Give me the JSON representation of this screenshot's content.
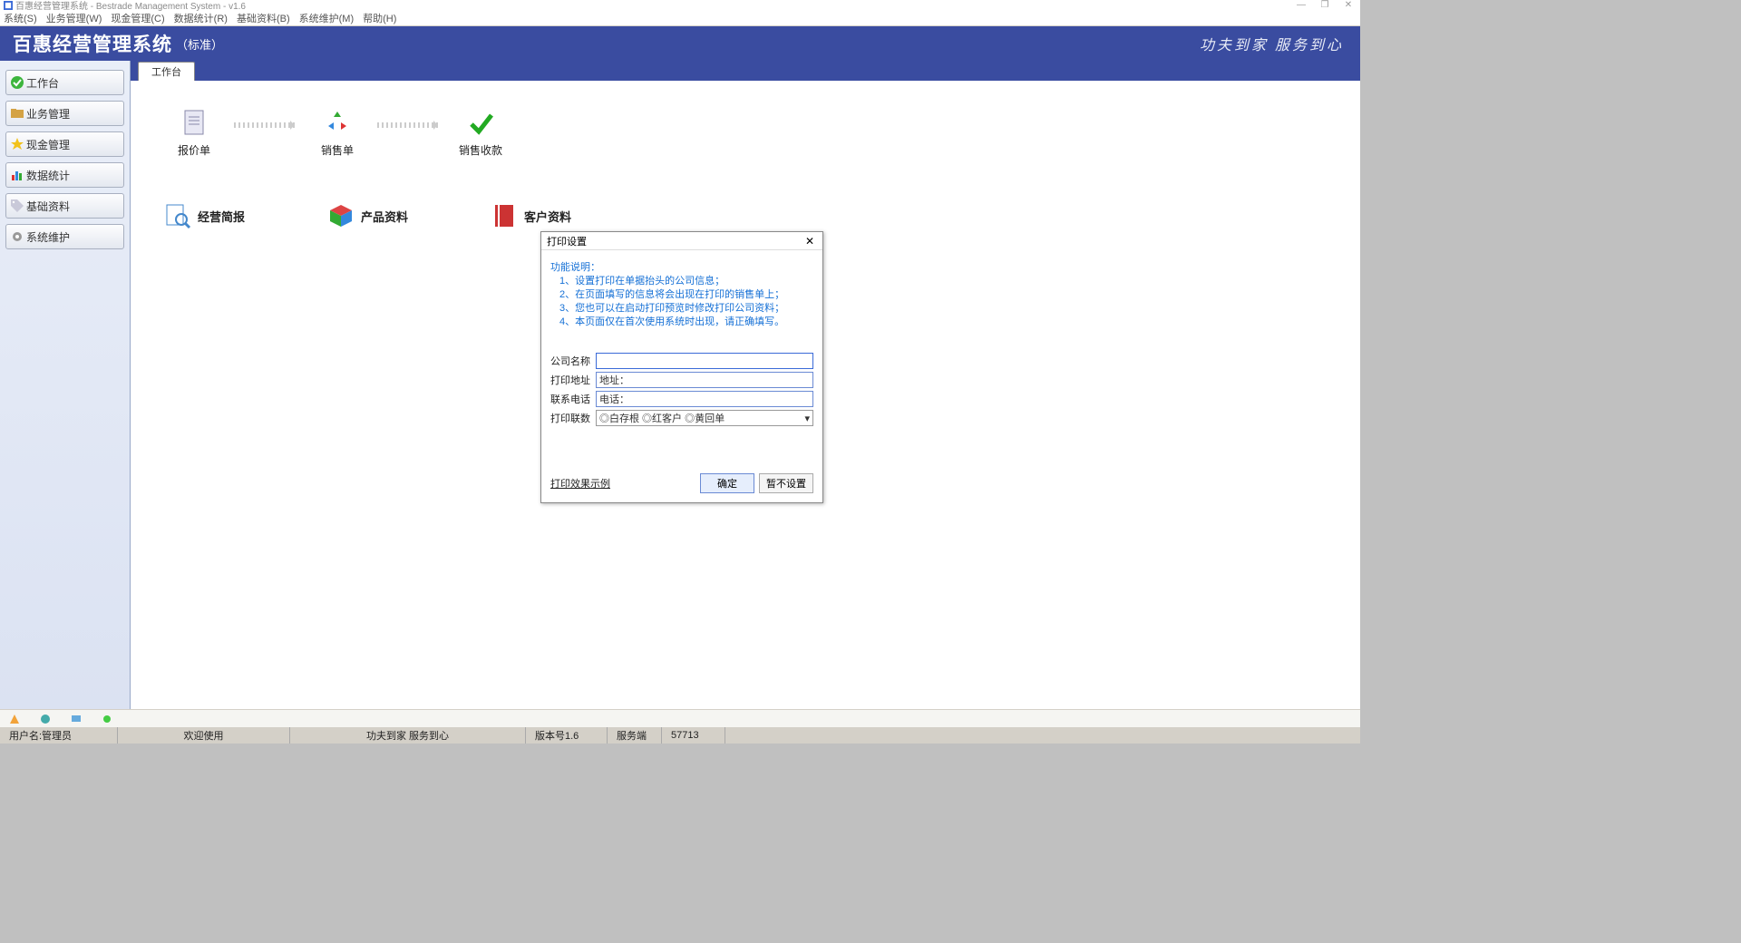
{
  "window": {
    "title": "百惠经营管理系统 - Bestrade Management System - v1.6",
    "minimize": "—",
    "maximize": "❐",
    "close": "✕"
  },
  "menu": [
    "系统(S)",
    "业务管理(W)",
    "现金管理(C)",
    "数据统计(R)",
    "基础资料(B)",
    "系统维护(M)",
    "帮助(H)"
  ],
  "brand": {
    "title": "百惠经营管理系统",
    "subtitle": "（标准）",
    "slogan": "功夫到家 服务到心"
  },
  "sidebar": [
    {
      "label": "工作台",
      "icon": "check"
    },
    {
      "label": "业务管理",
      "icon": "folder"
    },
    {
      "label": "现金管理",
      "icon": "star"
    },
    {
      "label": "数据统计",
      "icon": "chart"
    },
    {
      "label": "基础资料",
      "icon": "tag"
    },
    {
      "label": "系统维护",
      "icon": "gear"
    }
  ],
  "tab": "工作台",
  "flow": [
    "报价单",
    "销售单",
    "销售收款"
  ],
  "quick": [
    "经营简报",
    "产品资料",
    "客户资料"
  ],
  "dialog": {
    "title": "打印设置",
    "desc_title": "功能说明：",
    "desc": [
      "1、设置打印在单据抬头的公司信息；",
      "2、在页面填写的信息将会出现在打印的销售单上；",
      "3、您也可以在启动打印预览时修改打印公司资料；",
      "4、本页面仅在首次使用系统时出现，请正确填写。"
    ],
    "fields": {
      "company_label": "公司名称",
      "company_value": "",
      "address_label": "打印地址",
      "address_value": "地址：",
      "phone_label": "联系电话",
      "phone_value": "电话：",
      "copies_label": "打印联数",
      "copies_value": "◎白存根 ◎红客户 ◎黄回单"
    },
    "link": "打印效果示例",
    "ok": "确定",
    "cancel": "暂不设置"
  },
  "status": {
    "user": "用户名:管理员",
    "welcome": "欢迎使用",
    "slogan": "功夫到家 服务到心",
    "version": "版本号1.6",
    "server": "服务端",
    "port": "57713"
  }
}
